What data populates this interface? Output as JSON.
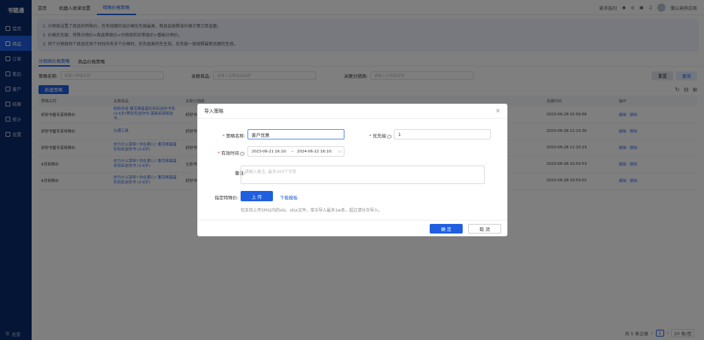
{
  "sidebar": {
    "logo": "书链通",
    "items": [
      {
        "label": "首页"
      },
      {
        "label": "商品"
      },
      {
        "label": "订单"
      },
      {
        "label": "售后"
      },
      {
        "label": "客户"
      },
      {
        "label": "结算"
      },
      {
        "label": "统计"
      },
      {
        "label": "设置"
      }
    ],
    "footer": "总览"
  },
  "topbar": {
    "tabs": [
      "首页",
      "机器人收单设置",
      "特殊价格策略"
    ],
    "right": {
      "guide": "新手指引",
      "company": "蒲公英供应商"
    }
  },
  "notice": [
    "1. 分销商设置了商品的特殊价，在有效期内该价格优先级最高，商品会按照该价格计算订单金额。",
    "2. 价格优先级：特殊分销价>商品等级价>分销商折扣等级价>基础分销价。",
    "3. 同个分销商同个商品在同个时间内有多个价格时，优先级高的先生效，优先级一致按照最新创建的生效。"
  ],
  "subtabs": [
    "分销商价格策略",
    "商品价格策略"
  ],
  "filters": {
    "policy_label": "策略名称:",
    "policy_ph": "请输入策略名称",
    "goods_label": "关联商品:",
    "goods_ph": "请输入关联商品名称",
    "dist_label": "关联分销商:",
    "dist_ph": "请输入分销商名称",
    "reset": "重置",
    "search": "查询"
  },
  "new_button": "新建策略",
  "table": {
    "headers": [
      "策略名称",
      "关联商品",
      "关联分销商",
      "创建时间",
      "操作"
    ],
    "rows": [
      {
        "name": "好好书屋专享特殊价",
        "goods": "粉粉传奇·要克棒蛋蛋形彩虹迷你书系(3-6岁)等彩色迷你书·漫画阅读精选书...",
        "dist": "好好书...",
        "time": "2023-06-28 15:59:58"
      },
      {
        "name": "好好书屋专享特殊价",
        "goods": "交通工具",
        "dist": "好好书...",
        "time": "2023-06-28 11:23:30"
      },
      {
        "name": "好好书屋专享特殊价",
        "goods": "你为什么哭呀? 你在哪儿? 要克棒蛋蛋形彩虹迷你书 (3-6岁)",
        "dist": "好好书...",
        "time": "2023-06-28 11:15:23"
      },
      {
        "name": "6月特殊价",
        "goods": "你为什么哭呀? 你在哪儿? 要克棒蛋蛋形彩虹迷你书 (3-6岁)",
        "dist": "七彩书...",
        "time": "2023-06-28 10:54:53"
      },
      {
        "name": "6月特殊价",
        "goods": "你为什么哭呀? 你在哪儿? 要克棒蛋蛋形彩虹迷你书 (3-6岁)",
        "dist": "好好书...",
        "time": "2023-06-28 10:53:02"
      }
    ],
    "ops": [
      "编辑",
      "删除"
    ]
  },
  "pagination": {
    "total": "共 5 条记录",
    "page": "1",
    "size": "20 条/页"
  },
  "modal": {
    "title": "导入策略",
    "name_label": "策略名称:",
    "name_value": "客户优惠",
    "priority_label": "优先级",
    "priority_value": "1",
    "time_label": "有效时间",
    "start": "2023-06-21 16:10:",
    "end": "2024-06-22 16:10:",
    "remark_label": "备注:",
    "remark_ph": "请输入备注, 最多200个字符",
    "price_label": "指定特殊价:",
    "upload": "上 传",
    "download": "下载模板",
    "hint": "仅支持上传5M以内的xls、xlsx文件，单次导入最多1w条，超过请分次导入。",
    "ok": "确 定",
    "cancel": "取 消"
  }
}
